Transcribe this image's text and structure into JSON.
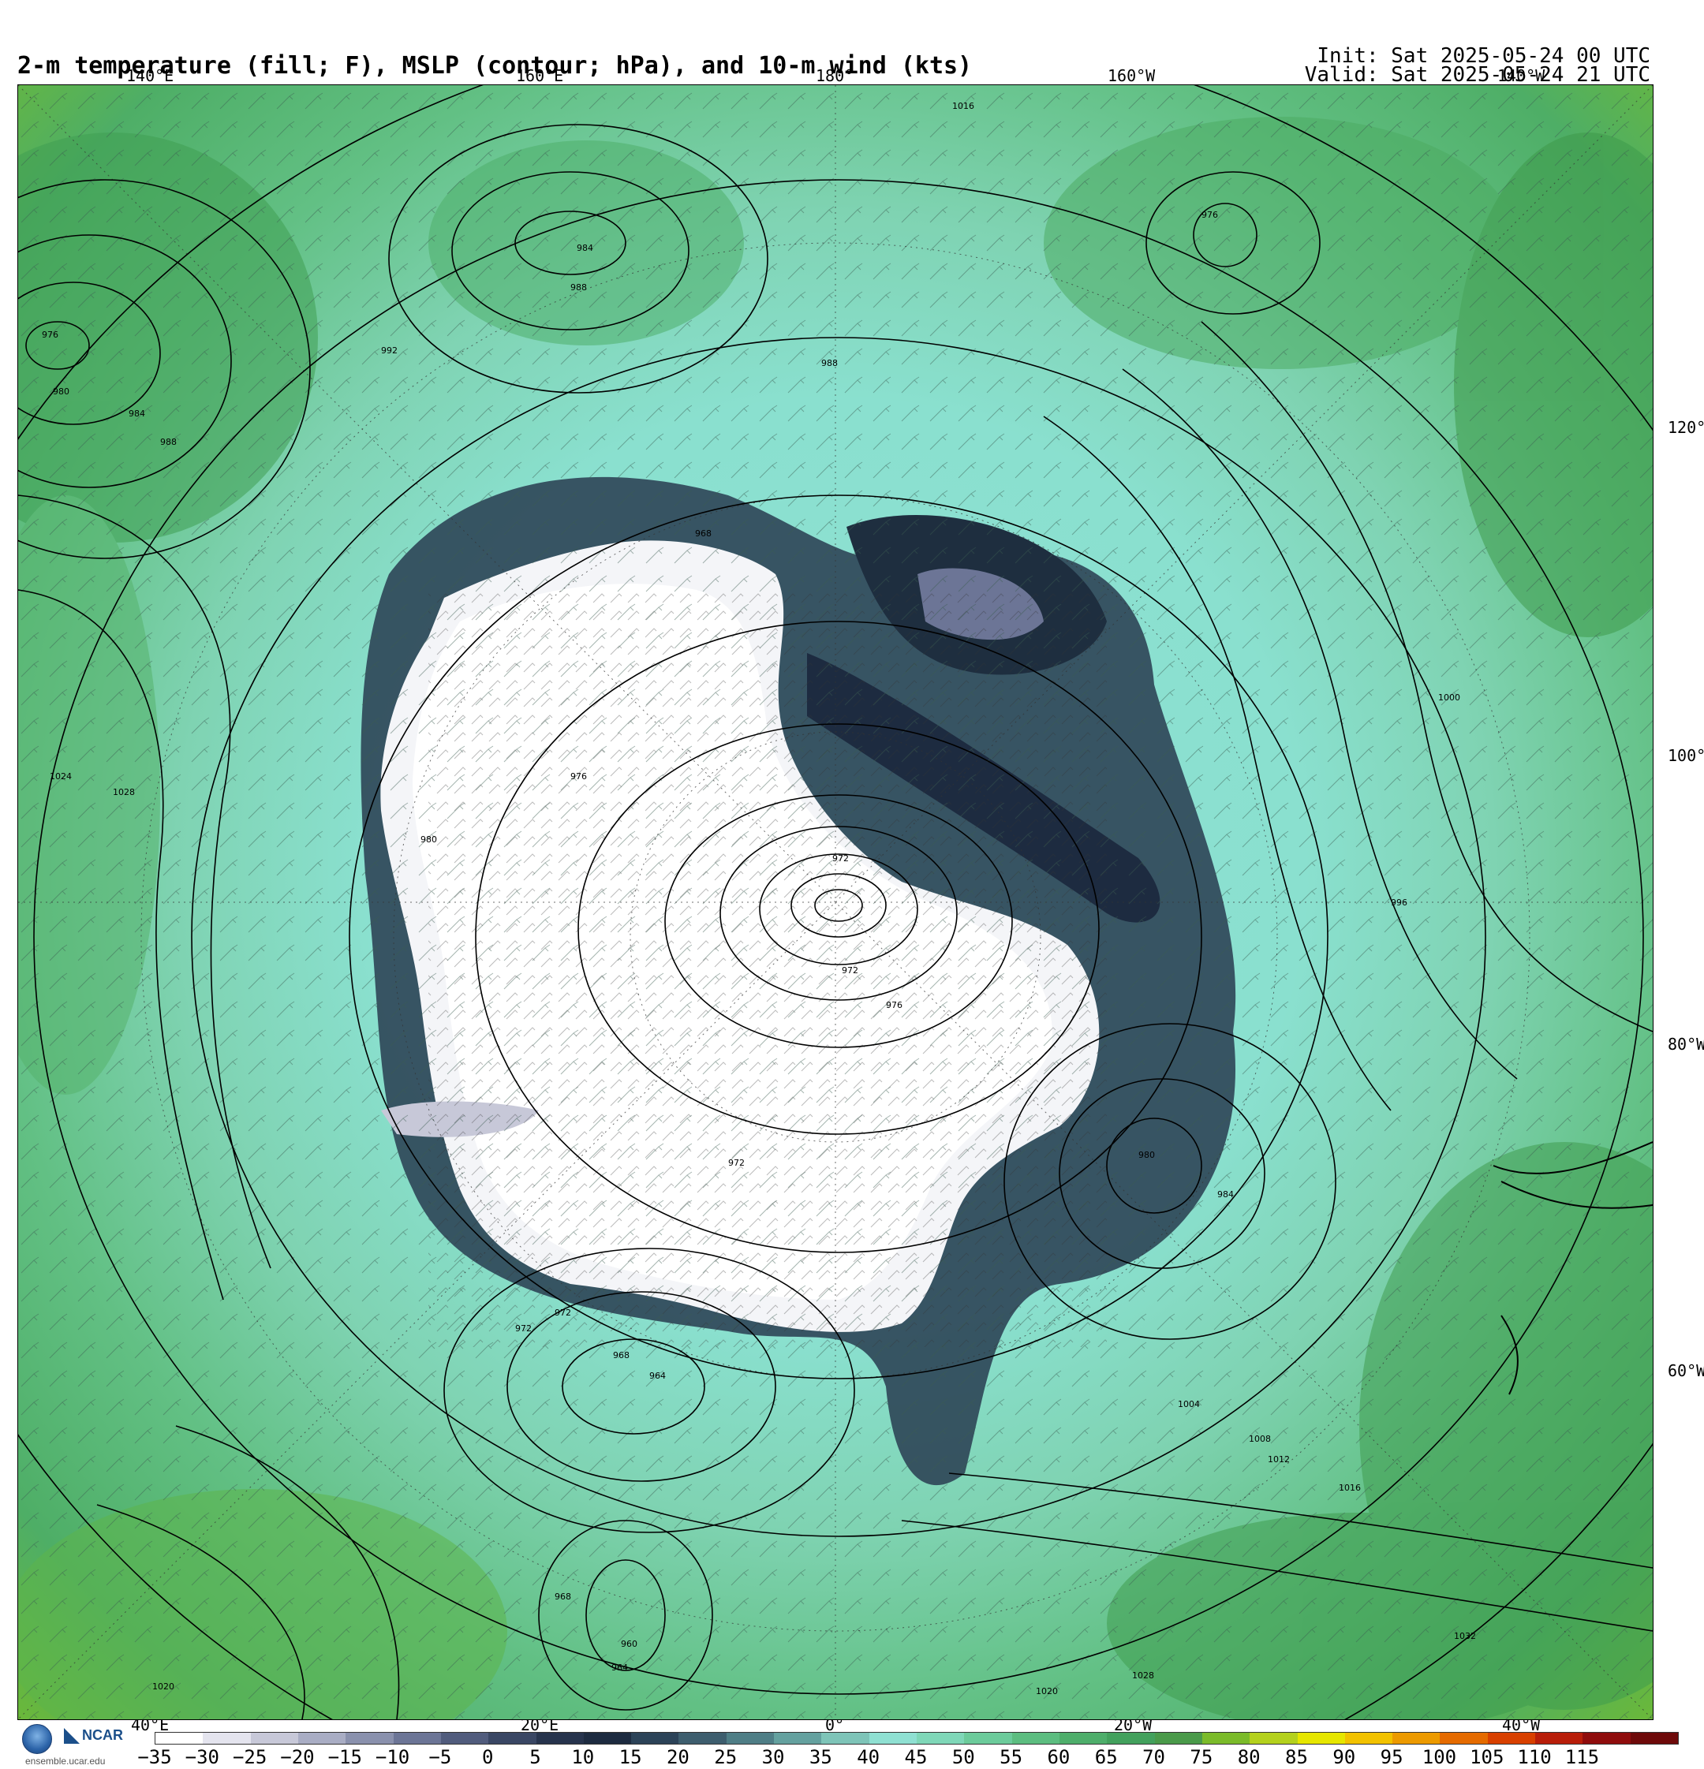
{
  "header": {
    "title": "2-m temperature (fill; F), MSLP (contour; hPa), and 10-m wind (kts)",
    "init": "Init: Sat 2025-05-24 00 UTC",
    "valid": "Valid: Sat 2025-05-24 21 UTC"
  },
  "map": {
    "projection": "south polar stereographic",
    "top_lon_labels": [
      "140°E",
      "160°E",
      "180°",
      "160°W",
      "140°W"
    ],
    "bottom_lon_labels": [
      "40°E",
      "20°E",
      "0°",
      "20°W",
      "40°W"
    ],
    "right_lat_labels": [
      "120°",
      "100°",
      "80°W",
      "60°W"
    ],
    "isobar_labels": [
      "1016",
      "976",
      "984",
      "988",
      "992",
      "976",
      "980",
      "984",
      "988",
      "988",
      "968",
      "972",
      "972",
      "976",
      "972",
      "972",
      "1000",
      "996",
      "980",
      "984",
      "1004",
      "1008",
      "1012",
      "1016",
      "1020",
      "1032",
      "1028",
      "972",
      "968",
      "964",
      "960",
      "964",
      "968",
      "976",
      "980",
      "1020",
      "1024",
      "1028"
    ]
  },
  "colorbar": {
    "labels": [
      "−35",
      "−30",
      "−25",
      "−20",
      "−15",
      "−10",
      "−5",
      "0",
      "5",
      "10",
      "15",
      "20",
      "25",
      "30",
      "35",
      "40",
      "45",
      "50",
      "55",
      "60",
      "65",
      "70",
      "75",
      "80",
      "85",
      "90",
      "95",
      "100",
      "105",
      "110",
      "115"
    ],
    "colors": [
      "#ffffff",
      "#e4e4ee",
      "#c7c8d8",
      "#a9adc4",
      "#8a91ad",
      "#6c7596",
      "#515c7d",
      "#3a4764",
      "#27344d",
      "#1d2b40",
      "#2c4358",
      "#3e5e6e",
      "#4f7e86",
      "#64a19f",
      "#7ec4b8",
      "#8fe0d2",
      "#7fd7b8",
      "#6ccb9b",
      "#5cbd80",
      "#4eae6b",
      "#43a15d",
      "#4a9a4a",
      "#7bbb2a",
      "#b4d11d",
      "#e6e600",
      "#f2c200",
      "#ec9a00",
      "#e56b00",
      "#d84000",
      "#b81e0a",
      "#8f0d0d",
      "#6e0a0a"
    ]
  },
  "logos": {
    "org": "NCAR",
    "site": "ensemble.ucar.edu"
  }
}
